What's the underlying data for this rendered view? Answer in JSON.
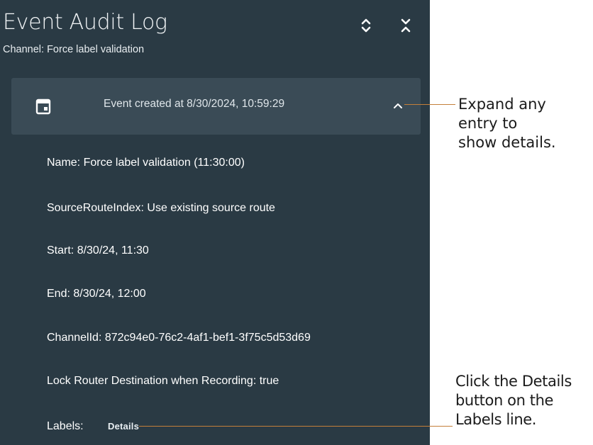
{
  "panel": {
    "title": "Event Audit Log",
    "subtitle": "Channel: Force label validation",
    "toolbar": {
      "expand_all_icon": "unfold-more-icon",
      "collapse_all_icon": "unfold-less-icon"
    },
    "background_color": "#2a3a44",
    "entry_color": "#3a4b56"
  },
  "entry": {
    "icon": "calendar-icon",
    "title": "Event created at 8/30/2024, 10:59:29",
    "chevron_icon": "chevron-up-icon",
    "expanded": true,
    "details": [
      {
        "label": "Name: ",
        "value": "Force label validation (11:30:00)"
      },
      {
        "label": "SourceRouteIndex: ",
        "value": "Use existing source route"
      },
      {
        "label": "Start: ",
        "value": "8/30/24, 11:30"
      },
      {
        "label": "End: ",
        "value": "8/30/24, 12:00"
      },
      {
        "label": "ChannelId: ",
        "value": "872c94e0-76c2-4af1-bef1-3f75c5d53d69"
      },
      {
        "label": "Lock Router Destination when Recording: ",
        "value": "true"
      }
    ],
    "labels_row": {
      "label": "Labels:",
      "button_label": "Details"
    }
  },
  "callouts": {
    "expand": [
      "Expand any",
      "entry to",
      "show details."
    ],
    "details": [
      "Click the Details",
      "button on the",
      "Labels line."
    ],
    "line_color": "#c47f3a"
  }
}
